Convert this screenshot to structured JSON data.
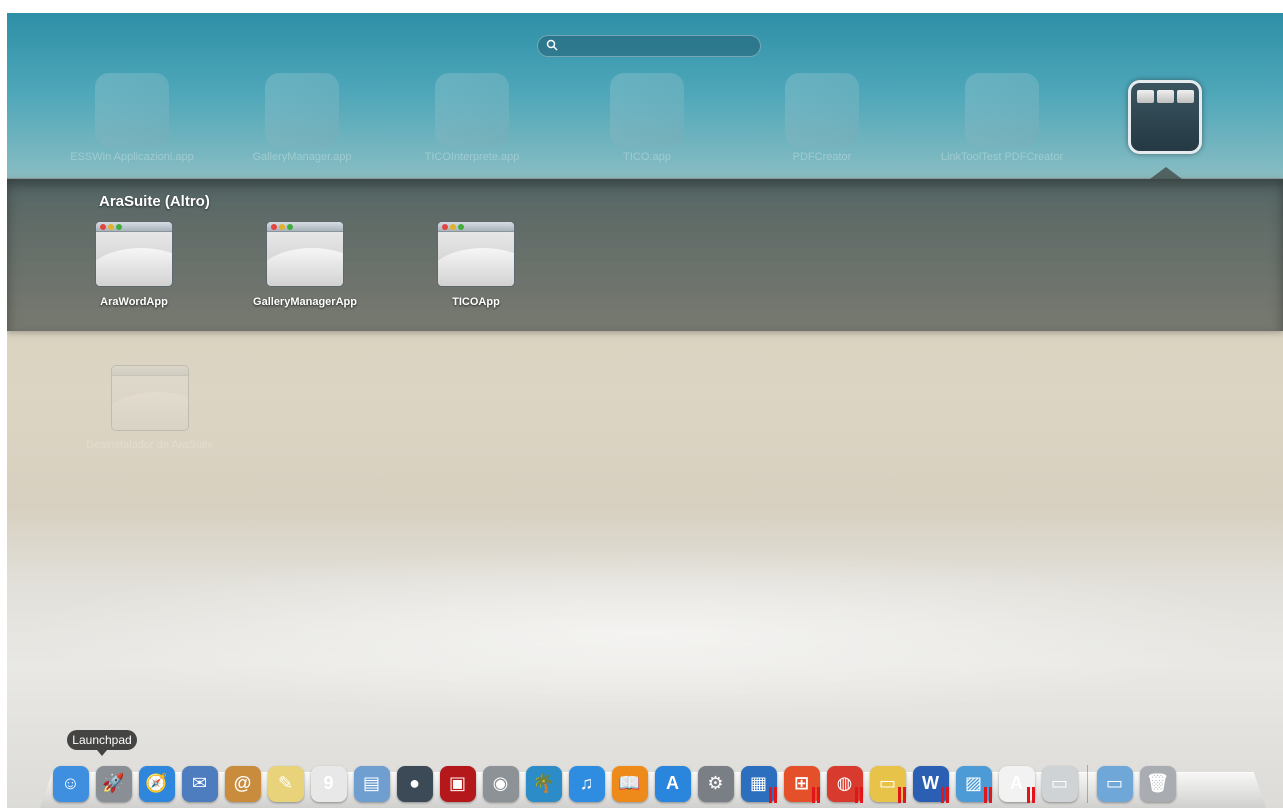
{
  "search": {
    "placeholder": ""
  },
  "launchpad_apps": [
    {
      "label": "ESSWin Applicazioni.app",
      "color": "#8fb7c0"
    },
    {
      "label": "GalleryManager.app",
      "color": "#9bbfc6"
    },
    {
      "label": "TICOInterprete.app",
      "color": "#8bb5c0"
    },
    {
      "label": "TICO.app",
      "color": "#8ab3bd"
    },
    {
      "label": "PDFCreator",
      "color": "#a9c6cc"
    },
    {
      "label": "LinkToolTest PDFCreator",
      "color": "#a2c2c9"
    }
  ],
  "folder": {
    "title": "AraSuite (Altro)",
    "apps": [
      {
        "label": "AraWordApp"
      },
      {
        "label": "GalleryManagerApp"
      },
      {
        "label": "TICOApp"
      }
    ]
  },
  "ghost_app": {
    "label": "Desinstalador de AraSuite"
  },
  "dock": {
    "tooltip": "Launchpad",
    "items": [
      {
        "name": "finder-icon",
        "glyph": "☺",
        "color": "#3e8fe0"
      },
      {
        "name": "launchpad-icon",
        "glyph": "🚀",
        "color": "#8a8f96"
      },
      {
        "name": "safari-icon",
        "glyph": "🧭",
        "color": "#2f86dd"
      },
      {
        "name": "mail-icon",
        "glyph": "✉",
        "color": "#4d7cbf"
      },
      {
        "name": "contacts-icon",
        "glyph": "@",
        "color": "#c98b3c"
      },
      {
        "name": "notes-icon",
        "glyph": "✎",
        "color": "#e8d27a"
      },
      {
        "name": "calendar-icon",
        "glyph": "9",
        "color": "#e8e8e8"
      },
      {
        "name": "preview-icon",
        "glyph": "▤",
        "color": "#6f9fd1"
      },
      {
        "name": "facetime-icon",
        "glyph": "●",
        "color": "#3c4a57"
      },
      {
        "name": "photobooth-icon",
        "glyph": "▣",
        "color": "#b5181b"
      },
      {
        "name": "screenshot-icon",
        "glyph": "◉",
        "color": "#8d9296"
      },
      {
        "name": "iphoto-icon",
        "glyph": "🌴",
        "color": "#2c8cc7"
      },
      {
        "name": "itunes-icon",
        "glyph": "♫",
        "color": "#2e8de0"
      },
      {
        "name": "ibooks-icon",
        "glyph": "📖",
        "color": "#ee8a19"
      },
      {
        "name": "appstore-icon",
        "glyph": "A",
        "color": "#2a85dd"
      },
      {
        "name": "system-preferences-icon",
        "glyph": "⚙",
        "color": "#7a7f85"
      },
      {
        "name": "parallels-desktop-icon",
        "glyph": "▦",
        "color": "#2c6fbf",
        "paused": true
      },
      {
        "name": "windows-icon",
        "glyph": "⊞",
        "color": "#e3502a",
        "paused": true
      },
      {
        "name": "chrome-icon",
        "glyph": "◍",
        "color": "#d83b2e",
        "paused": true
      },
      {
        "name": "folder-explorer-icon",
        "glyph": "▭",
        "color": "#e7c34a",
        "paused": true
      },
      {
        "name": "word-icon",
        "glyph": "W",
        "color": "#2b5fb3",
        "paused": true
      },
      {
        "name": "photo-viewer-icon",
        "glyph": "▨",
        "color": "#4c9bd6",
        "paused": true
      },
      {
        "name": "araword-icon",
        "glyph": "A",
        "color": "#f2f2f2",
        "paused": true
      },
      {
        "name": "generic-app-icon",
        "glyph": "▭",
        "color": "#cfd3d6"
      },
      {
        "name": "separator",
        "separator": true
      },
      {
        "name": "applications-folder-icon",
        "glyph": "▭",
        "color": "#6fa8d8"
      },
      {
        "name": "trash-icon",
        "glyph": "🗑",
        "color": "#a9adb1"
      }
    ]
  }
}
